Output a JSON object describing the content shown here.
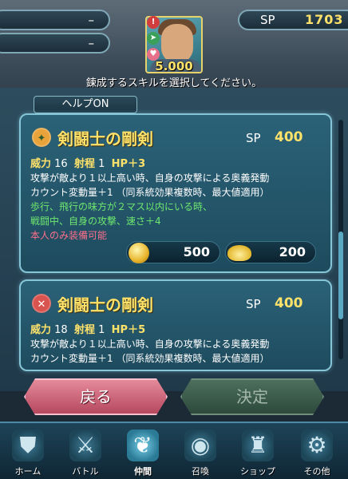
{
  "header": {
    "pill1_value": "–",
    "pill2_value": "–",
    "sp_label": "SP",
    "sp_value": "1703",
    "portrait_value": "5.000",
    "instruction": "鍊成するスキルを選択してください。"
  },
  "help_tab": "ヘルプON",
  "cards": [
    {
      "name": "剣闘士の剛剣",
      "sp_label": "SP",
      "sp_value": "400",
      "stat_might_label": "威力",
      "stat_might": "16",
      "stat_range_label": "射程",
      "stat_range": "1",
      "stat_hp": "HP＋3",
      "desc1": "攻撃が敵より１以上高い時、自身の攻撃による奥義発動",
      "desc2": "カウント変動量＋1 （同系統効果複数時、最大値適用）",
      "desc3": "歩行、飛行の味方が２マス以内にいる時、",
      "desc4": "戦闘中、自身の攻撃、速さ＋4",
      "desc5": "本人のみ装備可能",
      "cost_coin": "500",
      "cost_dew": "200"
    },
    {
      "name": "剣闘士の剛剣",
      "sp_label": "SP",
      "sp_value": "400",
      "stat_might_label": "威力",
      "stat_might": "18",
      "stat_range_label": "射程",
      "stat_range": "1",
      "stat_hp": "HP＋5",
      "desc1": "攻撃が敵より１以上高い時、自身の攻撃による奥義発動",
      "desc2": "カウント変動量＋1 （同系統効果複数時、最大値適用）"
    }
  ],
  "buttons": {
    "back": "戻る",
    "confirm": "決定"
  },
  "nav": [
    {
      "label": "ホーム",
      "icon": "home-icon"
    },
    {
      "label": "バトル",
      "icon": "swords-icon"
    },
    {
      "label": "仲間",
      "icon": "wing-icon"
    },
    {
      "label": "召喚",
      "icon": "orb-icon"
    },
    {
      "label": "ショップ",
      "icon": "castle-icon"
    },
    {
      "label": "その他",
      "icon": "gear-icon"
    }
  ],
  "colors": {
    "accent_gold": "#ffe26a",
    "green_text": "#6fe86f",
    "pink_text": "#ff6e8a",
    "back_button": "#c85a70",
    "confirm_button_disabled": "#3d5c4c"
  }
}
